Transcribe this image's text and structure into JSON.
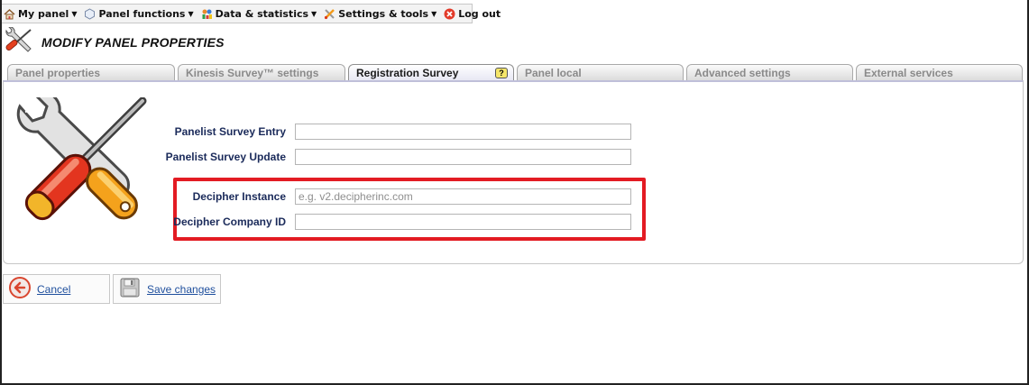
{
  "menu": {
    "items": [
      {
        "label": "My panel",
        "icon": "home-icon"
      },
      {
        "label": "Panel functions",
        "icon": "hexagon-icon"
      },
      {
        "label": "Data & statistics",
        "icon": "chart-people-icon"
      },
      {
        "label": "Settings & tools",
        "icon": "tools-icon"
      },
      {
        "label": "Log out",
        "icon": "power-off-icon"
      }
    ]
  },
  "header": {
    "title": "MODIFY PANEL PROPERTIES"
  },
  "tabs": [
    {
      "label": "Panel properties",
      "active": false
    },
    {
      "label": "Kinesis Survey™ settings",
      "active": false
    },
    {
      "label": "Registration Survey",
      "active": true,
      "help": "?"
    },
    {
      "label": "Panel local",
      "active": false
    },
    {
      "label": "Advanced settings",
      "active": false
    },
    {
      "label": "External services",
      "active": false
    }
  ],
  "form": {
    "fields": [
      {
        "label": "Panelist Survey Entry",
        "value": "",
        "placeholder": ""
      },
      {
        "label": "Panelist Survey Update",
        "value": "",
        "placeholder": ""
      },
      {
        "label": "Decipher Instance",
        "value": "",
        "placeholder": "e.g. v2.decipherinc.com"
      },
      {
        "label": "Decipher Company ID",
        "value": "",
        "placeholder": ""
      }
    ]
  },
  "actions": {
    "cancel_label": "Cancel",
    "save_label": "Save changes"
  },
  "colors": {
    "highlight": "#e31b23",
    "link": "#1f4f9d",
    "label": "#1a2a5a"
  }
}
